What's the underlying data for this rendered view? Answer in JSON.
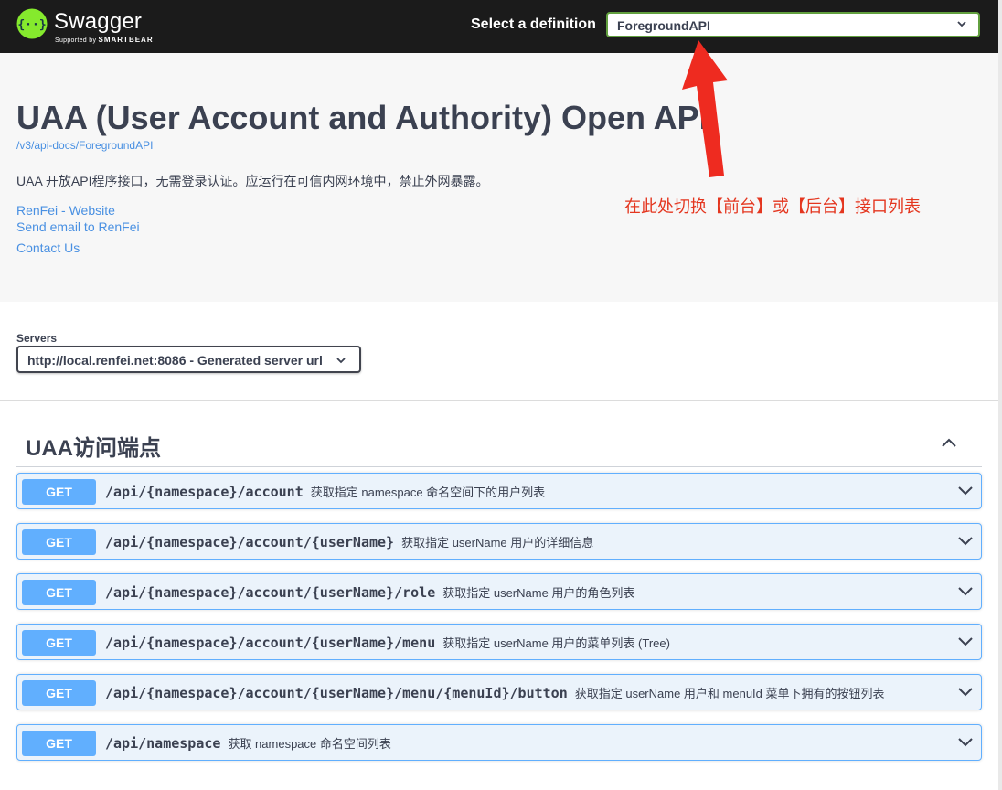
{
  "topbar": {
    "brand": "Swagger",
    "brand_sub_prefix": "Supported by",
    "brand_sub_company": "SMARTBEAR",
    "definition_label": "Select a definition",
    "definition_value": "ForegroundAPI"
  },
  "info": {
    "title": "UAA (User Account and Authority) Open API",
    "url": "/v3/api-docs/ForegroundAPI",
    "description": "UAA 开放API程序接口，无需登录认证。应运行在可信内网环境中，禁止外网暴露。",
    "links": [
      "RenFei - Website",
      "Send email to RenFei",
      "Contact Us"
    ],
    "annotation": "在此处切换【前台】或【后台】接口列表"
  },
  "servers": {
    "label": "Servers",
    "selected": "http://local.renfei.net:8086 - Generated server url"
  },
  "tag": {
    "title": "UAA访问端点"
  },
  "operations": [
    {
      "method": "GET",
      "path": "/api/{namespace}/account",
      "summary": "获取指定 namespace 命名空间下的用户列表"
    },
    {
      "method": "GET",
      "path": "/api/{namespace}/account/{userName}",
      "summary": "获取指定 userName 用户的详细信息"
    },
    {
      "method": "GET",
      "path": "/api/{namespace}/account/{userName}/role",
      "summary": "获取指定 userName 用户的角色列表"
    },
    {
      "method": "GET",
      "path": "/api/{namespace}/account/{userName}/menu",
      "summary": "获取指定 userName 用户的菜单列表 (Tree)"
    },
    {
      "method": "GET",
      "path": "/api/{namespace}/account/{userName}/menu/{menuId}/button",
      "summary": "获取指定 userName 用户和 menuId 菜单下拥有的按钮列表"
    },
    {
      "method": "GET",
      "path": "/api/namespace",
      "summary": "获取 namespace 命名空间列表"
    }
  ],
  "colors": {
    "topbar_bg": "#1b1b1b",
    "get_method": "#61affe",
    "get_bg": "#ebf3fb",
    "link": "#4990e2",
    "annotation": "#e4361f",
    "brand_green": "#85ea2d"
  }
}
